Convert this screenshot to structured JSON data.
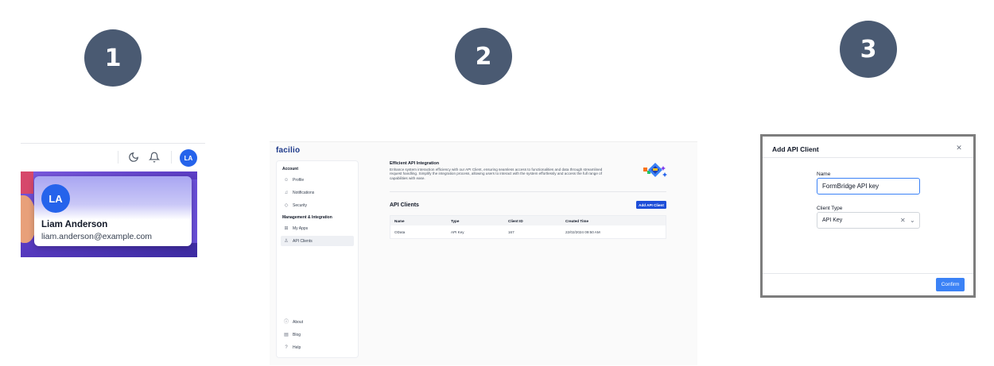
{
  "steps": [
    "1",
    "2",
    "3"
  ],
  "panel1": {
    "toolbar": {
      "icons": [
        "moon-icon",
        "bell-icon"
      ],
      "avatar_initials": "LA"
    },
    "profile_card": {
      "initials": "LA",
      "name": "Liam Anderson",
      "email": "liam.anderson@example.com"
    }
  },
  "panel2": {
    "logo": "facilio",
    "sidebar": {
      "section_account": "Account",
      "account_items": [
        {
          "label": "Profile",
          "icon": "user-icon"
        },
        {
          "label": "Notifications",
          "icon": "bell-icon"
        },
        {
          "label": "Security",
          "icon": "shield-icon"
        }
      ],
      "section_management": "Management & Integration",
      "management_items": [
        {
          "label": "My Apps",
          "icon": "grid-icon"
        },
        {
          "label": "API Clients",
          "icon": "user-key-icon",
          "active": true
        }
      ],
      "footer_items": [
        {
          "label": "About",
          "icon": "info-icon"
        },
        {
          "label": "Blog",
          "icon": "document-icon"
        },
        {
          "label": "Help",
          "icon": "question-icon"
        }
      ]
    },
    "header": {
      "title": "Efficient API Integration",
      "description": "Enhance system interaction efficiency with our API Client, ensuring seamless access to functionalities and data through streamlined request handling. Simplify the integration process, allowing users to interact with the system effortlessly and access the full range of capabilities with ease."
    },
    "section_title": "API Clients",
    "add_button": "Add API Client",
    "table": {
      "columns": [
        "Name",
        "Type",
        "Client ID",
        "Created Time"
      ],
      "rows": [
        [
          "OData",
          "API Key",
          "167",
          "22/02/2024 09:50 AM"
        ]
      ]
    }
  },
  "panel3": {
    "modal_title": "Add API Client",
    "name_label": "Name",
    "name_value": "FormBridge API key",
    "client_type_label": "Client Type",
    "client_type_value": "API Key",
    "confirm_label": "Confirm"
  },
  "colors": {
    "step_circle": "#4a5a72",
    "primary": "#1d4ed8",
    "confirm": "#3b82f6",
    "avatar": "#2563eb"
  }
}
